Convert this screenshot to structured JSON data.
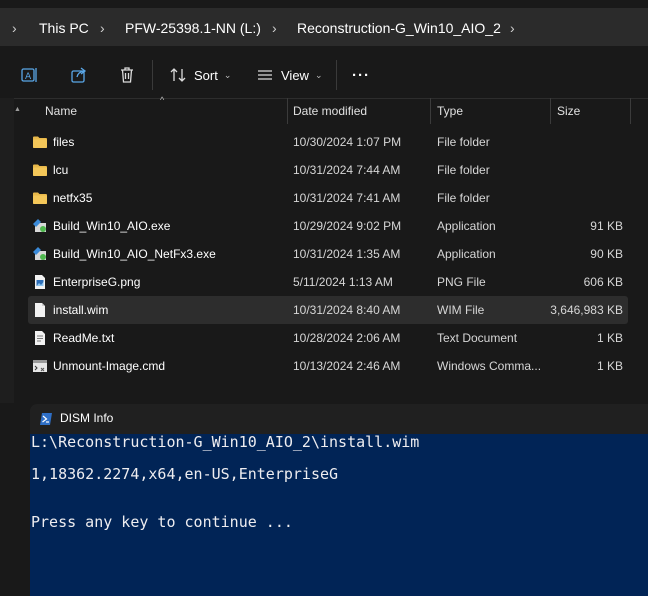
{
  "breadcrumb": [
    {
      "label": "This PC"
    },
    {
      "label": "PFW-25398.1-NN (L:)"
    },
    {
      "label": "Reconstruction-G_Win10_AIO_2"
    }
  ],
  "toolbar": {
    "sort_label": "Sort",
    "view_label": "View",
    "more_label": "···"
  },
  "columns": {
    "name": "Name",
    "date": "Date modified",
    "type": "Type",
    "size": "Size"
  },
  "files": [
    {
      "name": "files",
      "date": "10/30/2024 1:07 PM",
      "type": "File folder",
      "size": "",
      "icon": "folder-icon"
    },
    {
      "name": "lcu",
      "date": "10/31/2024 7:44 AM",
      "type": "File folder",
      "size": "",
      "icon": "folder-icon"
    },
    {
      "name": "netfx35",
      "date": "10/31/2024 7:41 AM",
      "type": "File folder",
      "size": "",
      "icon": "folder-icon"
    },
    {
      "name": "Build_Win10_AIO.exe",
      "date": "10/29/2024 9:02 PM",
      "type": "Application",
      "size": "91 KB",
      "icon": "script-app-icon"
    },
    {
      "name": "Build_Win10_AIO_NetFx3.exe",
      "date": "10/31/2024 1:35 AM",
      "type": "Application",
      "size": "90 KB",
      "icon": "script-app-icon"
    },
    {
      "name": "EnterpriseG.png",
      "date": "5/11/2024 1:13 AM",
      "type": "PNG File",
      "size": "606 KB",
      "icon": "image-file-icon"
    },
    {
      "name": "install.wim",
      "date": "10/31/2024 8:40 AM",
      "type": "WIM File",
      "size": "3,646,983 KB",
      "icon": "generic-file-icon",
      "selected": true
    },
    {
      "name": "ReadMe.txt",
      "date": "10/28/2024 2:06 AM",
      "type": "Text Document",
      "size": "1 KB",
      "icon": "text-file-icon"
    },
    {
      "name": "Unmount-Image.cmd",
      "date": "10/13/2024 2:46 AM",
      "type": "Windows Comma...",
      "size": "1 KB",
      "icon": "cmd-file-icon"
    }
  ],
  "console": {
    "title": "DISM Info",
    "lines": [
      "L:\\Reconstruction-G_Win10_AIO_2\\install.wim",
      "1,18362.2274,x64,en-US,EnterpriseG",
      "Press any key to continue ..."
    ]
  },
  "colors": {
    "folder": "#e8b84a",
    "console_bg": "#012456",
    "selection": "#2d2d2d"
  }
}
